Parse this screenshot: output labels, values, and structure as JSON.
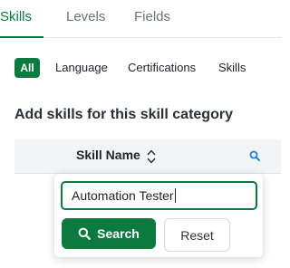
{
  "tabs": [
    {
      "label": "Skills",
      "active": true
    },
    {
      "label": "Levels",
      "active": false
    },
    {
      "label": "Fields",
      "active": false
    }
  ],
  "filters": [
    {
      "label": "All",
      "active": true
    },
    {
      "label": "Language",
      "active": false
    },
    {
      "label": "Certifications",
      "active": false
    },
    {
      "label": "Skills",
      "active": false
    }
  ],
  "section_title": "Add skills for this skill category",
  "table": {
    "column_header": "Skill Name",
    "sort_icon": "sort-updown-icon",
    "filter_icon": "search-icon"
  },
  "search_popover": {
    "input_value": "Automation Tester",
    "search_label": "Search",
    "reset_label": "Reset",
    "search_icon": "search-icon"
  },
  "colors": {
    "accent": "#0b7a3e",
    "header_bg": "#f2f4f6",
    "icon_blue": "#1a7fd6"
  }
}
